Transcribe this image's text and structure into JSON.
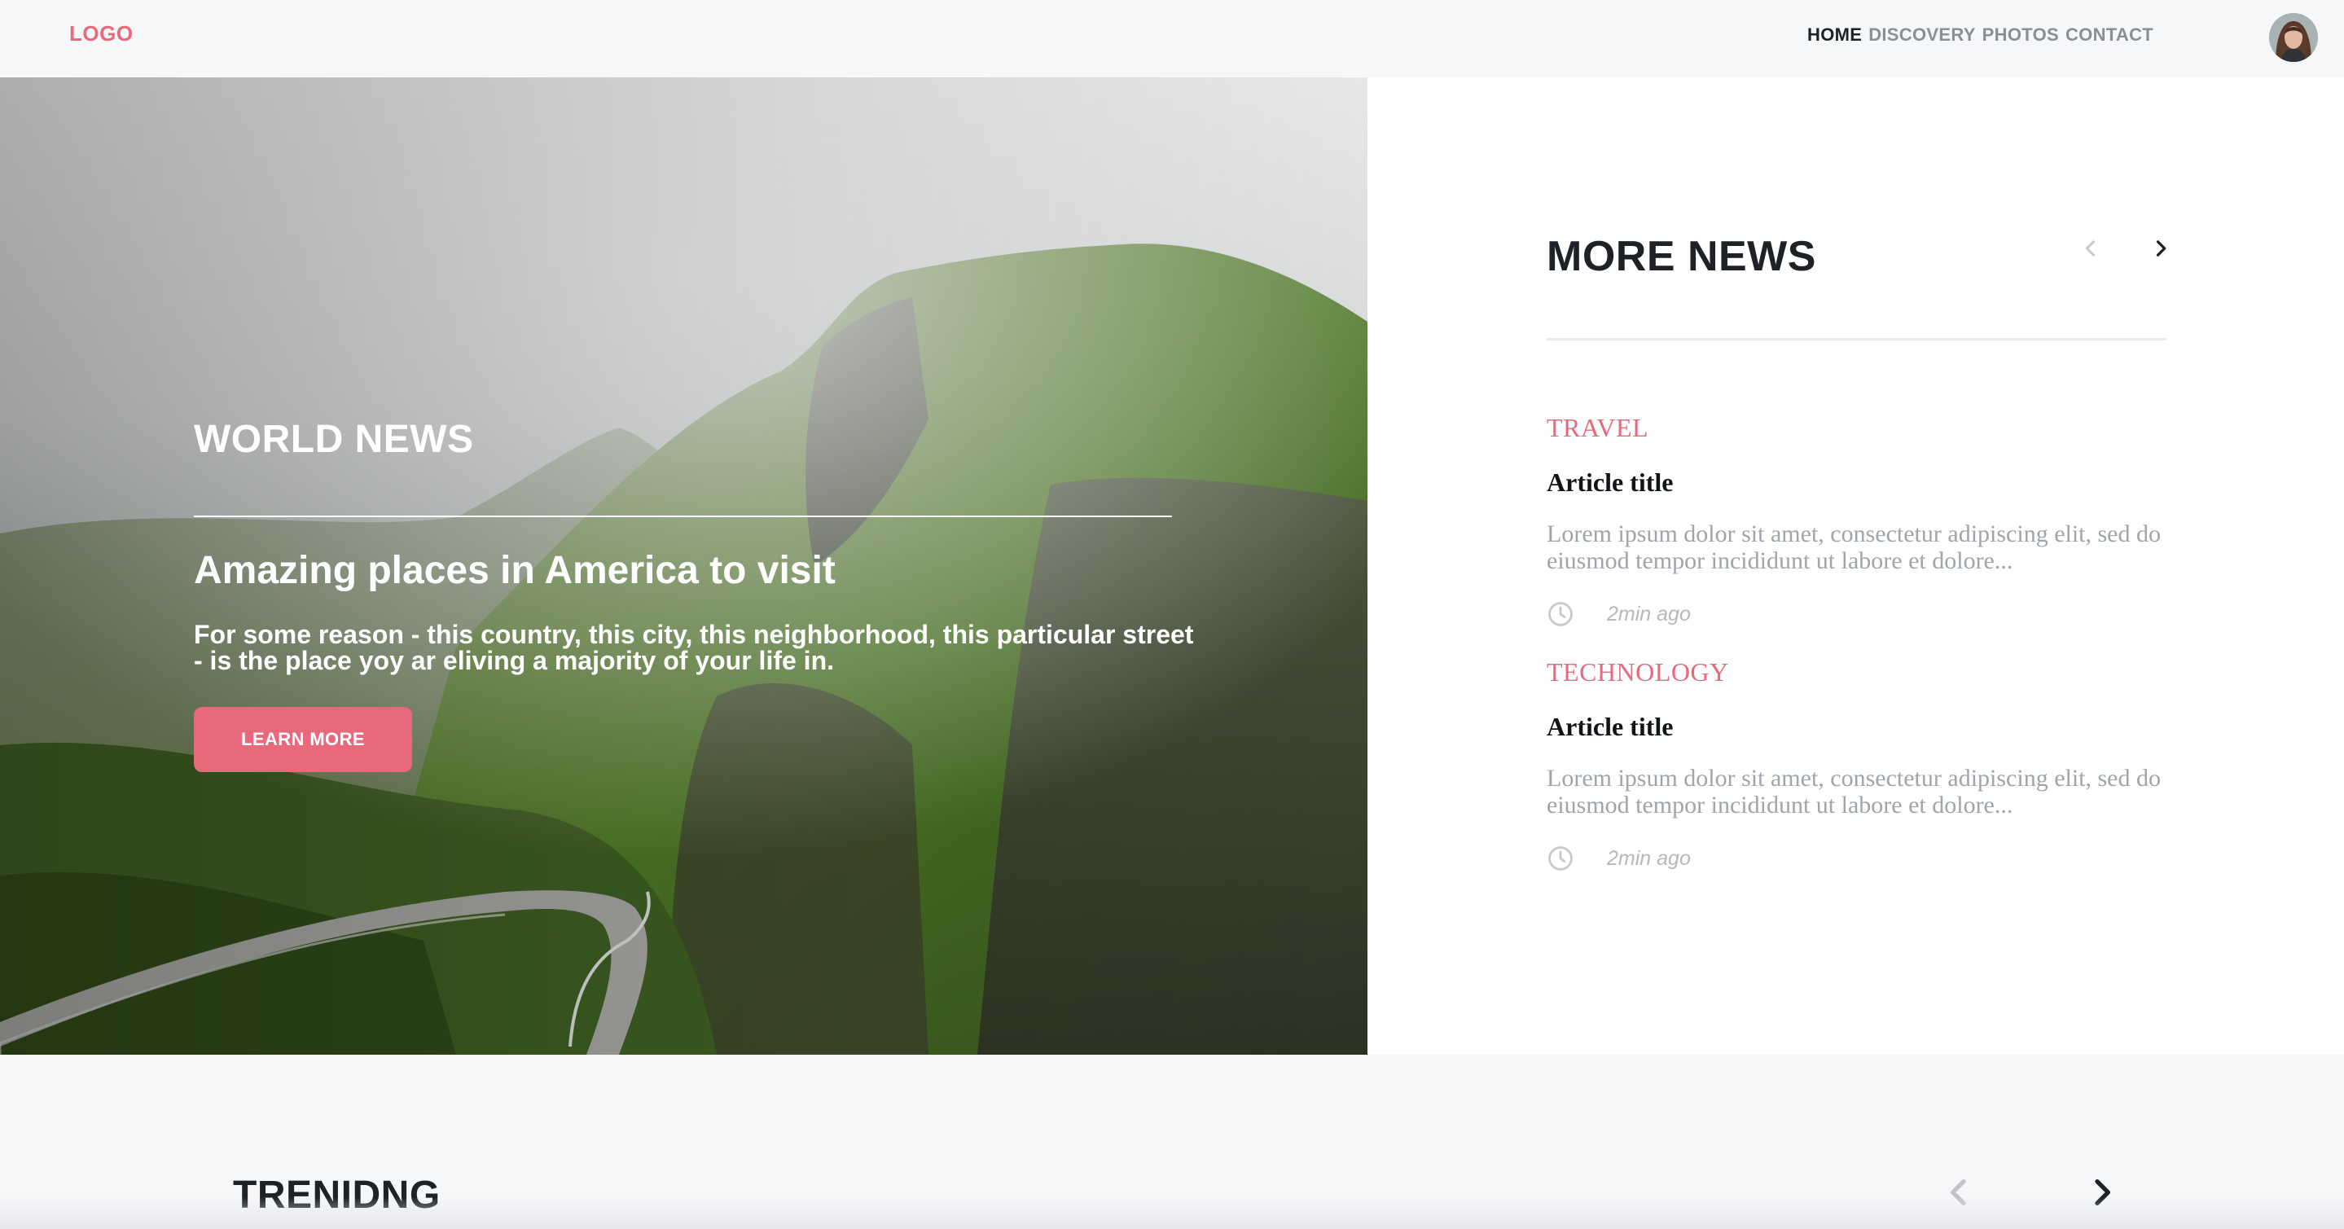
{
  "brand": {
    "logo": "LOGO",
    "accent": "#e8697c"
  },
  "nav": {
    "items": [
      {
        "label": "HOME",
        "active": true
      },
      {
        "label": "DISCOVERY",
        "active": false
      },
      {
        "label": "PHOTOS",
        "active": false
      },
      {
        "label": "CONTACT",
        "active": false
      }
    ],
    "avatar_icon": "user-avatar"
  },
  "hero": {
    "tag": "WORLD NEWS",
    "title": "Amazing places in America to visit",
    "description": "For some reason - this country, this city, this neighborhood, this particular street - is the place yoy ar eliving a majority of your life in.",
    "button": "LEARN MORE",
    "image_icon": "mountain-landscape-photo"
  },
  "more_news": {
    "title": "MORE NEWS",
    "prev_icon": "chevron-left-icon",
    "next_icon": "chevron-right-icon",
    "articles": [
      {
        "category": "TRAVEL",
        "title": "Article title",
        "excerpt": "Lorem ipsum dolor sit amet, consectetur adipiscing elit, sed do eiusmod tempor incididunt ut labore et dolore...",
        "time": "2min ago"
      },
      {
        "category": "TECHNOLOGY",
        "title": "Article title",
        "excerpt": "Lorem ipsum dolor sit amet, consectetur adipiscing elit, sed do eiusmod tempor incididunt ut labore et dolore...",
        "time": "2min ago"
      }
    ]
  },
  "trending": {
    "title": "TRENIDNG",
    "prev_icon": "chevron-left-icon",
    "next_icon": "chevron-right-icon"
  }
}
